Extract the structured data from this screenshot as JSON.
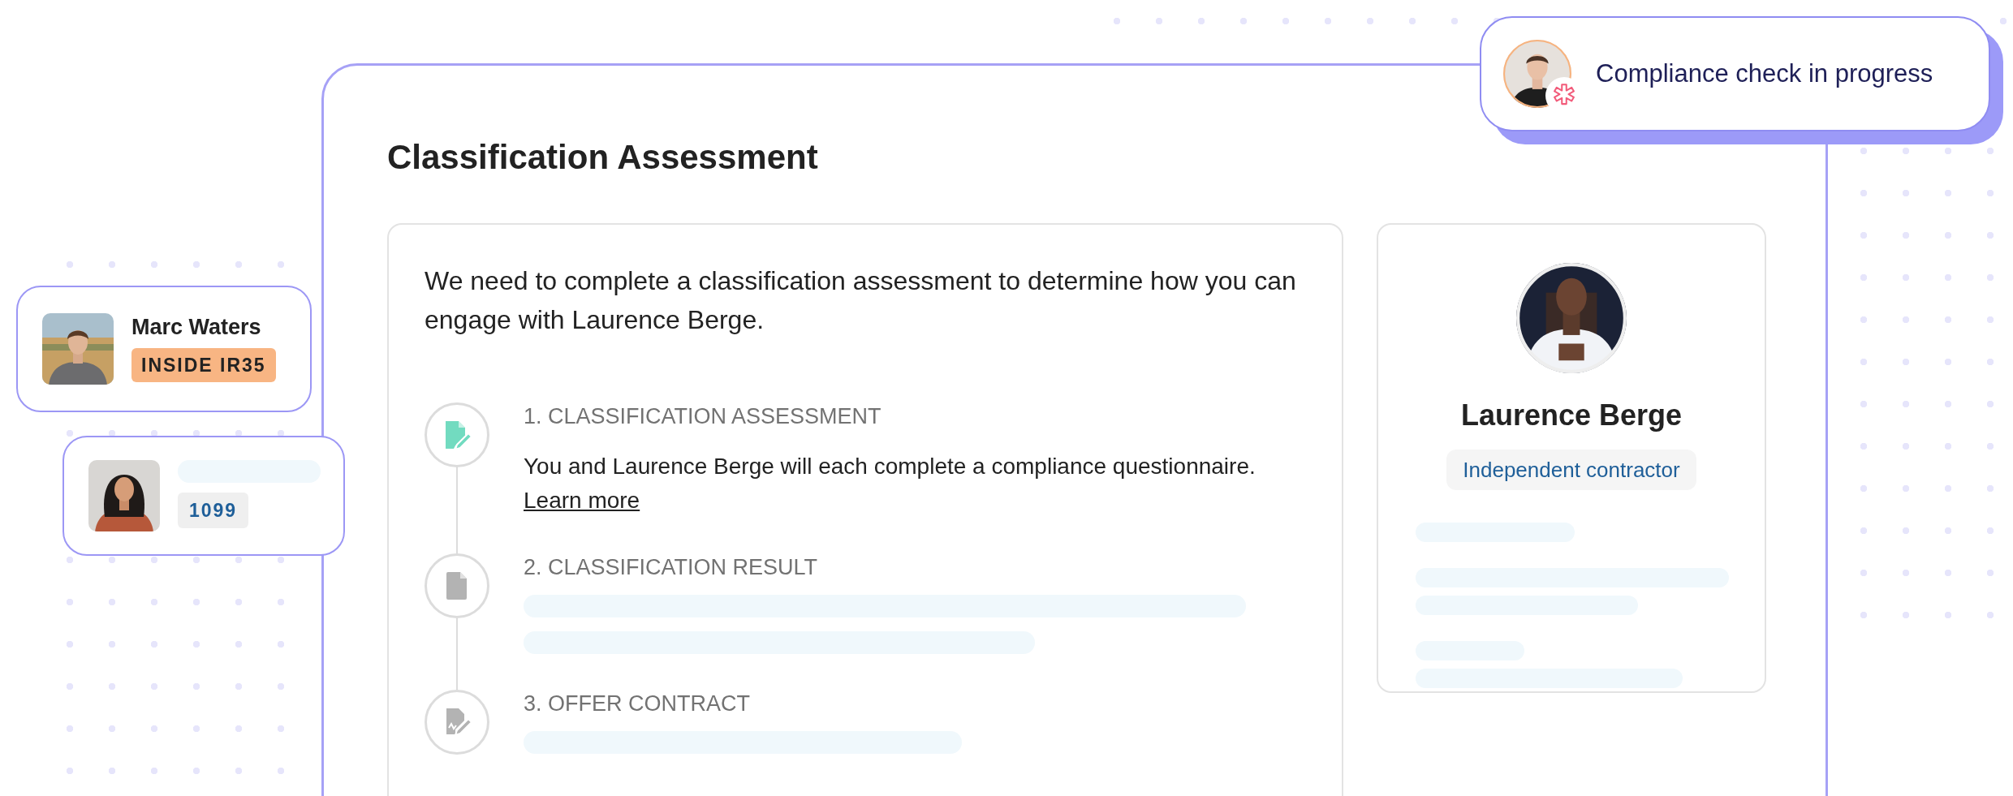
{
  "status_pill": {
    "text": "Compliance check in progress"
  },
  "people": [
    {
      "name": "Marc Waters",
      "tag": "INSIDE IR35",
      "color": "#f8b583"
    },
    {
      "tag": "1099",
      "color": "#efefef"
    }
  ],
  "assessment": {
    "title": "Classification Assessment",
    "intro": "We need to complete a classification assessment to determine how you can engage with Laurence Berge.",
    "steps": [
      {
        "kind": "edit",
        "active": true,
        "label": "1. CLASSIFICATION ASSESSMENT",
        "description": "You and Laurence Berge will each complete a compliance questionnaire.",
        "link": "Learn more"
      },
      {
        "kind": "file",
        "active": false,
        "label": "2. CLASSIFICATION RESULT"
      },
      {
        "kind": "sign",
        "active": false,
        "label": "3. OFFER CONTRACT"
      }
    ]
  },
  "contractor": {
    "name": "Laurence Berge",
    "type": "Independent contractor"
  }
}
